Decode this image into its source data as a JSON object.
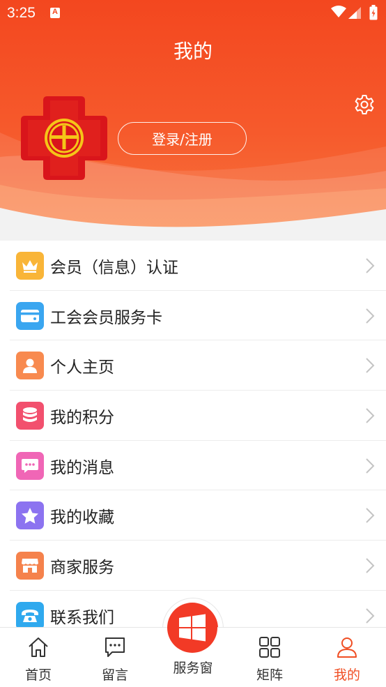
{
  "status_bar": {
    "time": "3:25",
    "notification_letter": "A"
  },
  "header": {
    "title": "我的",
    "login_label": "登录/注册"
  },
  "menu": {
    "items": [
      {
        "label": "会员（信息）认证",
        "icon": "crown-icon",
        "color": "#f9b538"
      },
      {
        "label": "工会会员服务卡",
        "icon": "card-icon",
        "color": "#3aa6f0"
      },
      {
        "label": "个人主页",
        "icon": "person-icon",
        "color": "#f88a4f"
      },
      {
        "label": "我的积分",
        "icon": "coins-icon",
        "color": "#f2506e"
      },
      {
        "label": "我的消息",
        "icon": "chat-icon",
        "color": "#f066b6"
      },
      {
        "label": "我的收藏",
        "icon": "star-icon",
        "color": "#8c73f0"
      },
      {
        "label": "商家服务",
        "icon": "store-icon",
        "color": "#f5824c"
      },
      {
        "label": "联系我们",
        "icon": "phone-icon",
        "color": "#2fa9ee"
      }
    ]
  },
  "tabbar": {
    "tabs": [
      {
        "label": "首页",
        "icon": "home-icon"
      },
      {
        "label": "留言",
        "icon": "message-icon"
      },
      {
        "label": "服务窗",
        "icon": "windows-icon"
      },
      {
        "label": "矩阵",
        "icon": "grid-icon"
      },
      {
        "label": "我的",
        "icon": "user-icon",
        "active": true
      }
    ],
    "active_color": "#f04e23"
  }
}
